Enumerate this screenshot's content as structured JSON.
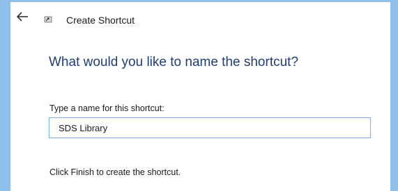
{
  "window": {
    "title": "Create Shortcut",
    "back_icon": "back-arrow-icon",
    "app_icon": "shortcut-icon"
  },
  "main": {
    "heading": "What would you like to name the shortcut?",
    "name_field": {
      "label": "Type a name for this shortcut:",
      "value": "SDS Library"
    },
    "footer_text": "Click Finish to create the shortcut."
  },
  "colors": {
    "desktop_background": "#8fc0ec",
    "heading": "#1f3d7a",
    "input_border": "#7ab0e0"
  }
}
